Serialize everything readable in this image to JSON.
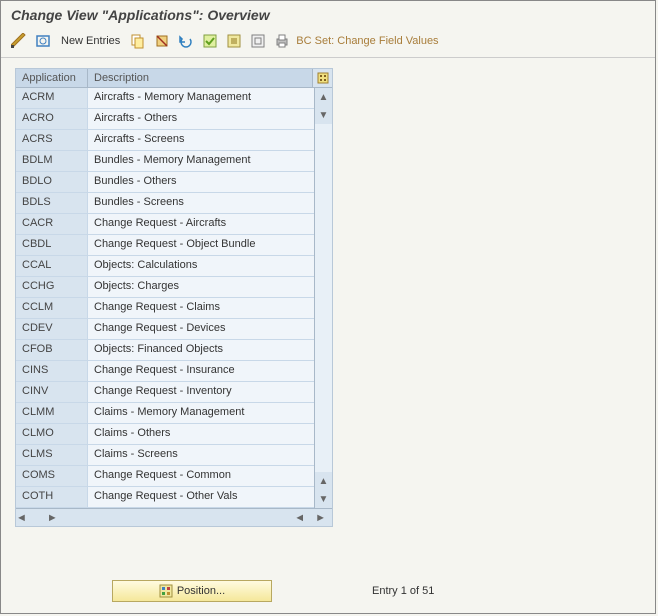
{
  "title": "Change View \"Applications\": Overview",
  "toolbar": {
    "new_entries": "New Entries",
    "bc_set": "BC Set: Change Field Values"
  },
  "table": {
    "headers": {
      "application": "Application",
      "description": "Description"
    },
    "rows": [
      {
        "app": "ACRM",
        "desc": "Aircrafts - Memory Management"
      },
      {
        "app": "ACRO",
        "desc": "Aircrafts - Others"
      },
      {
        "app": "ACRS",
        "desc": "Aircrafts - Screens"
      },
      {
        "app": "BDLM",
        "desc": "Bundles - Memory Management"
      },
      {
        "app": "BDLO",
        "desc": "Bundles - Others"
      },
      {
        "app": "BDLS",
        "desc": "Bundles - Screens"
      },
      {
        "app": "CACR",
        "desc": "Change Request - Aircrafts"
      },
      {
        "app": "CBDL",
        "desc": "Change Request - Object Bundle"
      },
      {
        "app": "CCAL",
        "desc": "Objects: Calculations"
      },
      {
        "app": "CCHG",
        "desc": "Objects: Charges"
      },
      {
        "app": "CCLM",
        "desc": "Change Request - Claims"
      },
      {
        "app": "CDEV",
        "desc": "Change Request - Devices"
      },
      {
        "app": "CFOB",
        "desc": "Objects: Financed Objects"
      },
      {
        "app": "CINS",
        "desc": "Change Request - Insurance"
      },
      {
        "app": "CINV",
        "desc": "Change Request - Inventory"
      },
      {
        "app": "CLMM",
        "desc": "Claims - Memory Management"
      },
      {
        "app": "CLMO",
        "desc": "Claims - Others"
      },
      {
        "app": "CLMS",
        "desc": "Claims - Screens"
      },
      {
        "app": "COMS",
        "desc": "Change Request - Common"
      },
      {
        "app": "COTH",
        "desc": "Change Request - Other Vals"
      }
    ]
  },
  "footer": {
    "position_label": "Position...",
    "entry_status": "Entry 1 of 51"
  }
}
